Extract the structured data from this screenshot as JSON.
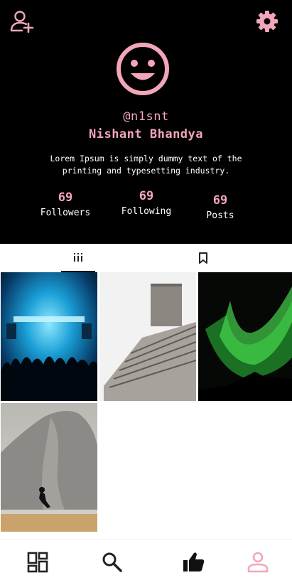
{
  "header": {
    "handle": "@n1snt",
    "name": "Nishant Bhandya",
    "bio": "Lorem Ipsum is simply dummy text of the printing and typesetting industry.",
    "icons": {
      "left": "add-user-icon",
      "right": "settings-icon"
    }
  },
  "stats": [
    {
      "value": "69",
      "label": "Followers"
    },
    {
      "value": "69",
      "label": "Following"
    },
    {
      "value": "69",
      "label": "Posts"
    }
  ],
  "tabs": [
    {
      "icon": "grid-icon",
      "active": true
    },
    {
      "icon": "bookmark-icon",
      "active": false
    }
  ],
  "posts": [
    {
      "subject": "concert-stage-blue-lights"
    },
    {
      "subject": "concrete-building"
    },
    {
      "subject": "green-aurora"
    },
    {
      "subject": "climber-cliff"
    }
  ],
  "bottom_nav": [
    {
      "icon": "dashboard-icon"
    },
    {
      "icon": "search-icon"
    },
    {
      "icon": "thumbs-up-icon"
    },
    {
      "icon": "profile-icon",
      "active": true
    }
  ],
  "colors": {
    "accent": "#f3a6b9",
    "header_bg": "#000000",
    "text_light": "#ffffff",
    "nav_icon": "#222222"
  }
}
